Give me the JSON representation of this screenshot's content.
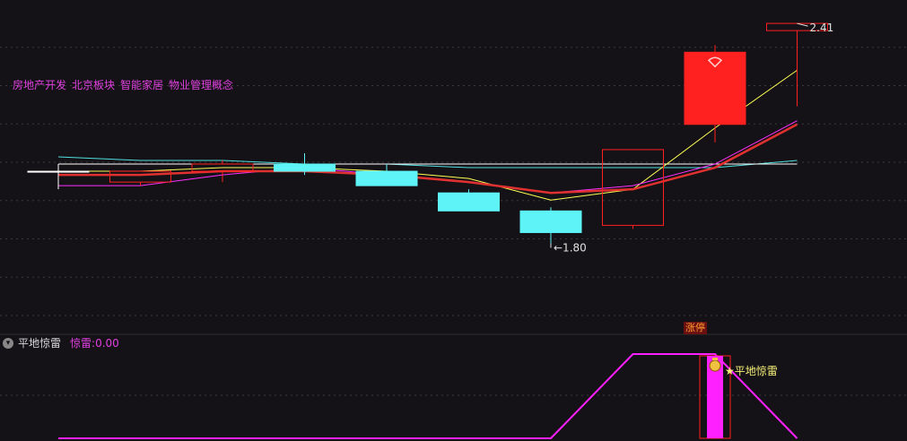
{
  "concepts": [
    "房地产开发",
    "北京板块",
    "智能家居",
    "物业管理概念"
  ],
  "indicator": {
    "name": "平地惊雷",
    "value_label": "惊雷:",
    "value": "0.00",
    "signal_label": "平地惊雷"
  },
  "badge": {
    "limit_up": "涨停"
  },
  "colors": {
    "background": "#141216",
    "up": "#ff2020",
    "down": "#5ef3f7",
    "ma1": "#ffffff",
    "ma2": "#ffff55",
    "ma3": "#ff30ff",
    "ma4": "#e03030",
    "ma5": "#50e0e0",
    "indicator": "#ff20ff",
    "grid": "#3a3a3a"
  },
  "icons": {
    "collapse": "chevron-down-icon",
    "signal": "money-bag-icon",
    "limit_up_mark": "fan-icon"
  },
  "chart_data": [
    {
      "type": "candlestick",
      "price_min": 1.6,
      "price_max": 2.45,
      "candles": [
        {
          "open": 2.0,
          "high": 2.02,
          "low": 1.95,
          "close": 2.0,
          "dir": "flat"
        },
        {
          "open": 1.97,
          "high": 2.0,
          "low": 1.96,
          "close": 2.0,
          "dir": "up"
        },
        {
          "open": 2.0,
          "high": 2.03,
          "low": 1.97,
          "close": 2.02,
          "dir": "up"
        },
        {
          "open": 2.02,
          "high": 2.05,
          "low": 1.99,
          "close": 2.0,
          "dir": "down"
        },
        {
          "open": 2.0,
          "high": 2.02,
          "low": 1.96,
          "close": 1.96,
          "dir": "down"
        },
        {
          "open": 1.94,
          "high": 1.95,
          "low": 1.89,
          "close": 1.89,
          "dir": "down"
        },
        {
          "open": 1.89,
          "high": 1.9,
          "low": 1.8,
          "close": 1.83,
          "dir": "down"
        },
        {
          "open": 1.85,
          "high": 2.06,
          "low": 1.84,
          "close": 2.06,
          "dir": "up"
        },
        {
          "open": 2.13,
          "high": 2.35,
          "low": 2.08,
          "close": 2.33,
          "dir": "up_limit"
        },
        {
          "open": 2.41,
          "high": 2.41,
          "low": 2.18,
          "close": 2.39,
          "dir": "up"
        }
      ],
      "ma_series": [
        {
          "values": [
            2.02,
            2.02,
            2.02,
            2.02,
            2.02,
            2.02,
            2.02,
            2.02,
            2.02,
            2.02
          ]
        },
        {
          "values": [
            2.0,
            2.0,
            2.01,
            2.01,
            2.0,
            1.98,
            1.92,
            1.95,
            2.12,
            2.28
          ]
        },
        {
          "values": [
            1.96,
            1.96,
            1.99,
            2.01,
            1.99,
            1.97,
            1.94,
            1.96,
            2.02,
            2.14
          ]
        },
        {
          "values": [
            1.99,
            1.99,
            2.0,
            2.0,
            1.99,
            1.97,
            1.94,
            1.95,
            2.01,
            2.13
          ]
        },
        {
          "values": [
            2.04,
            2.03,
            2.03,
            2.02,
            2.02,
            2.01,
            2.01,
            2.01,
            2.01,
            2.03
          ]
        }
      ],
      "annotations": {
        "max": "2.41",
        "min": "1.80"
      }
    },
    {
      "type": "area",
      "values": [
        0,
        0,
        0,
        0,
        0,
        0,
        0,
        1,
        1,
        0
      ],
      "ylim": [
        0,
        1
      ],
      "signal_index": 8
    }
  ]
}
